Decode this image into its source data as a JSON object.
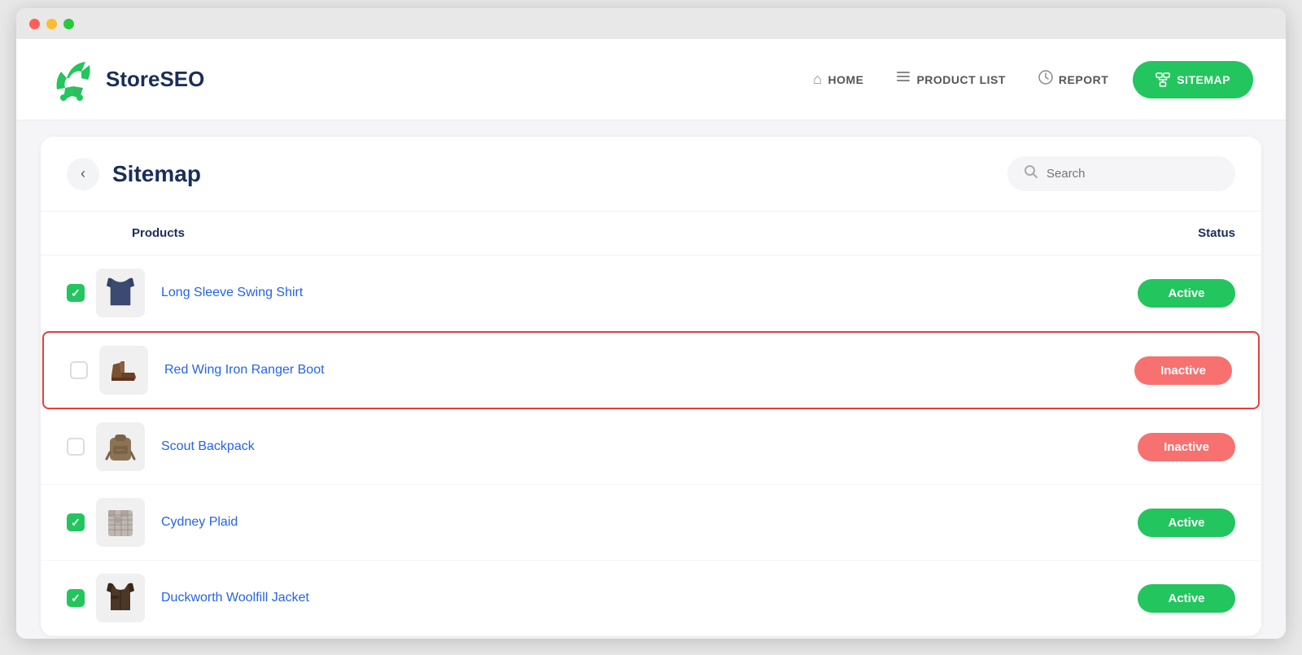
{
  "window": {
    "title": "StoreSEO"
  },
  "navbar": {
    "logo_text": "StoreSEO",
    "links": [
      {
        "id": "home",
        "label": "HOME",
        "icon": "⌂"
      },
      {
        "id": "product-list",
        "label": "PRODUCT LIST",
        "icon": "☰"
      },
      {
        "id": "report",
        "label": "REPORT",
        "icon": "📊"
      }
    ],
    "sitemap_btn": "SITEMAP"
  },
  "page": {
    "title": "Sitemap",
    "search_placeholder": "Search"
  },
  "table": {
    "col_products": "Products",
    "col_status": "Status"
  },
  "products": [
    {
      "id": "p1",
      "name": "Long Sleeve Swing Shirt",
      "checked": true,
      "status": "Active",
      "status_type": "active",
      "highlighted": false,
      "color": "#3b4a70"
    },
    {
      "id": "p2",
      "name": "Red Wing Iron Ranger Boot",
      "checked": false,
      "status": "Inactive",
      "status_type": "inactive",
      "highlighted": true,
      "color": "#7a5230"
    },
    {
      "id": "p3",
      "name": "Scout Backpack",
      "checked": false,
      "status": "Inactive",
      "status_type": "inactive",
      "highlighted": false,
      "color": "#8b7355"
    },
    {
      "id": "p4",
      "name": "Cydney Plaid",
      "checked": true,
      "status": "Active",
      "status_type": "active",
      "highlighted": false,
      "color": "#a0a0a0"
    },
    {
      "id": "p5",
      "name": "Duckworth Woolfill Jacket",
      "checked": true,
      "status": "Active",
      "status_type": "active",
      "highlighted": false,
      "color": "#4a3728"
    }
  ]
}
